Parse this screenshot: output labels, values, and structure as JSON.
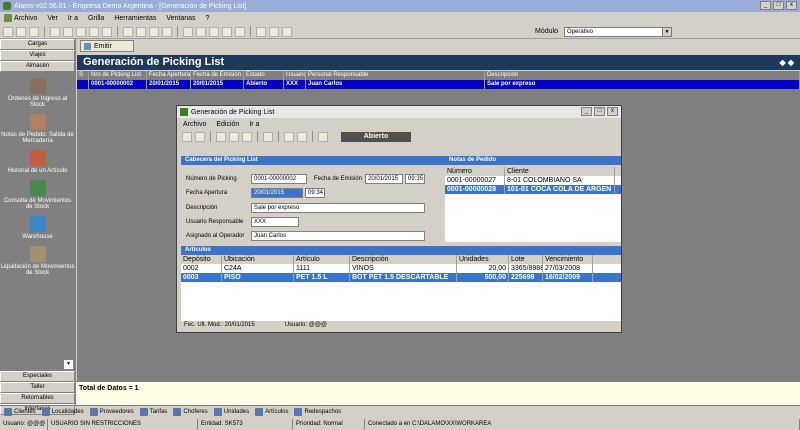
{
  "window": {
    "title": "Álamo v02.56.01 - Empresa Demo Argentina - [Generación de Picking List]"
  },
  "menu": [
    "Archivo",
    "Ver",
    "Ir a",
    "Grilla",
    "Herramientas",
    "Ventanas",
    "?"
  ],
  "toolbar": {
    "modulo_label": "Módulo",
    "modulo_value": "Operativo"
  },
  "sidebar": {
    "top_buttons": [
      "Cargas",
      "Viajes",
      "Almacén"
    ],
    "items": [
      "Ordenes de Ingreso al Stock",
      "Notas de Pedido: Salida de Mercadería",
      "Historial de un Artículo",
      "Consulta de Movimientos de Stock",
      "Warehouse",
      "Liquidación de Movimientos de Stock"
    ],
    "bottom_buttons": [
      "Especiales",
      "Taller",
      "Retornables",
      "Interfaces"
    ]
  },
  "emitir_label": "Emitir",
  "main_title": "Generación de Picking List",
  "main_grid": {
    "headers": [
      "S",
      "Nro de Picking List",
      "Fecha Apertura",
      "Fecha de Emisión",
      "Estado",
      "Usuario",
      "Personal Responsable",
      "Descripción"
    ],
    "rows": [
      [
        "",
        "0001-00000002",
        "20/01/2015",
        "20/01/2015",
        "Abierto",
        "XXX",
        "Juan Carlos",
        "Sale por expreso"
      ]
    ]
  },
  "dialog": {
    "title": "Generación de Picking List",
    "menu": [
      "Archivo",
      "Edición",
      "Ir a"
    ],
    "status": "Abierto",
    "cabecera_title": "Cabecera del Picking List",
    "notas_title": "Notas de Pedido",
    "articulos_title": "Artículos",
    "labels": {
      "numero": "Número de Picking",
      "fecha_emision": "Fecha de Emisión",
      "fecha_apertura": "Fecha Apertura",
      "descripcion": "Descripción",
      "usuario": "Usuario Responsable",
      "asignado": "Asignado al Operador"
    },
    "values": {
      "numero": "0001-00000002",
      "fecha_emision": "20/01/2015",
      "hora_emision": "09:35",
      "fecha_apertura": "20/01/2015",
      "hora_apertura": "09:34",
      "descripcion": "Sale por expreso",
      "usuario": "XXX",
      "asignado": "Juan Carlos"
    },
    "notas": {
      "headers": [
        "Número",
        "Cliente"
      ],
      "rows": [
        [
          "0001-00000027",
          "8-01 COLOMBIANO SA"
        ],
        [
          "0001-00000028",
          "101-01 COCA COLA DE ARGEN"
        ]
      ]
    },
    "articulos": {
      "headers": [
        "Depósito",
        "Ubicación",
        "Artículo",
        "Descripción",
        "Unidades",
        "Lote",
        "Vencimiento"
      ],
      "rows": [
        [
          "0002",
          "C24A",
          "1111",
          "VINOS",
          "20,00",
          "3365/8988",
          "27/03/2008"
        ],
        [
          "0003",
          "PISO",
          "PET 1.5 L",
          "BOT PET 1.5 DESCARTABLE",
          "500,00",
          "225698",
          "16/02/2009"
        ]
      ]
    },
    "footer": {
      "fec_label": "Fec. Ult. Mod.: 20/01/2015",
      "usuario_label": "Usuario: @@@"
    }
  },
  "status": {
    "total": "Total de Datos = 1"
  },
  "bottom_tabs": [
    "Clientes",
    "Localidades",
    "Proveedores",
    "Tarifas",
    "Choferes",
    "Unidades",
    "Artículos",
    "Redespachos"
  ],
  "statusbar": [
    "Usuario: @@@",
    "USUARIO SIN RESTRICCIONES",
    "Entidad: SK573",
    "Prioridad: Normal",
    "Conectado a  en C:\\DALAMO\\XX\\WORKAREA"
  ]
}
